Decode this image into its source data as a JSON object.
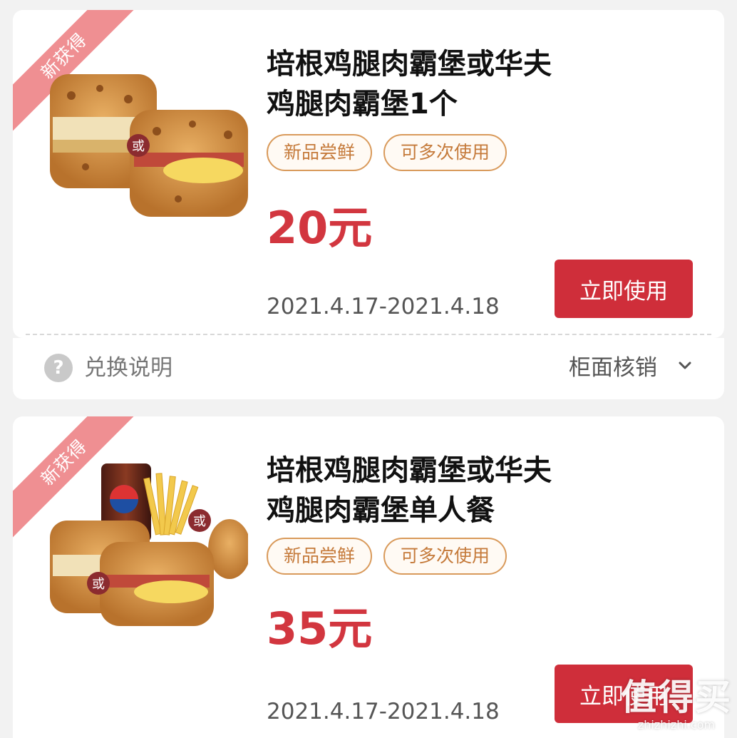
{
  "coupons": [
    {
      "badge": "新获得",
      "title_line1": "培根鸡腿肉霸堡或华夫",
      "title_line2": "鸡腿肉霸堡1个",
      "tags": [
        "新品尝鲜",
        "可多次使用"
      ],
      "price": "20元",
      "validity": "2021.4.17-2021.4.18",
      "use_button": "立即使用",
      "image_marker": "或"
    },
    {
      "badge": "新获得",
      "title_line1": "培根鸡腿肉霸堡或华夫",
      "title_line2": "鸡腿肉霸堡单人餐",
      "tags": [
        "新品尝鲜",
        "可多次使用"
      ],
      "price": "35元",
      "validity": "2021.4.17-2021.4.18",
      "use_button": "立即使用",
      "image_marker": "或"
    }
  ],
  "info_row": {
    "help_label": "兑换说明",
    "redeem_method": "柜面核销",
    "help_icon_glyph": "?"
  },
  "watermark": {
    "text": "值得买",
    "url": "zhizhizhi.com"
  },
  "colors": {
    "price_red": "#d2363f",
    "button_red": "#cf2e3a",
    "tag_orange": "#d99a5b",
    "ribbon_pink": "#ef8f92"
  }
}
